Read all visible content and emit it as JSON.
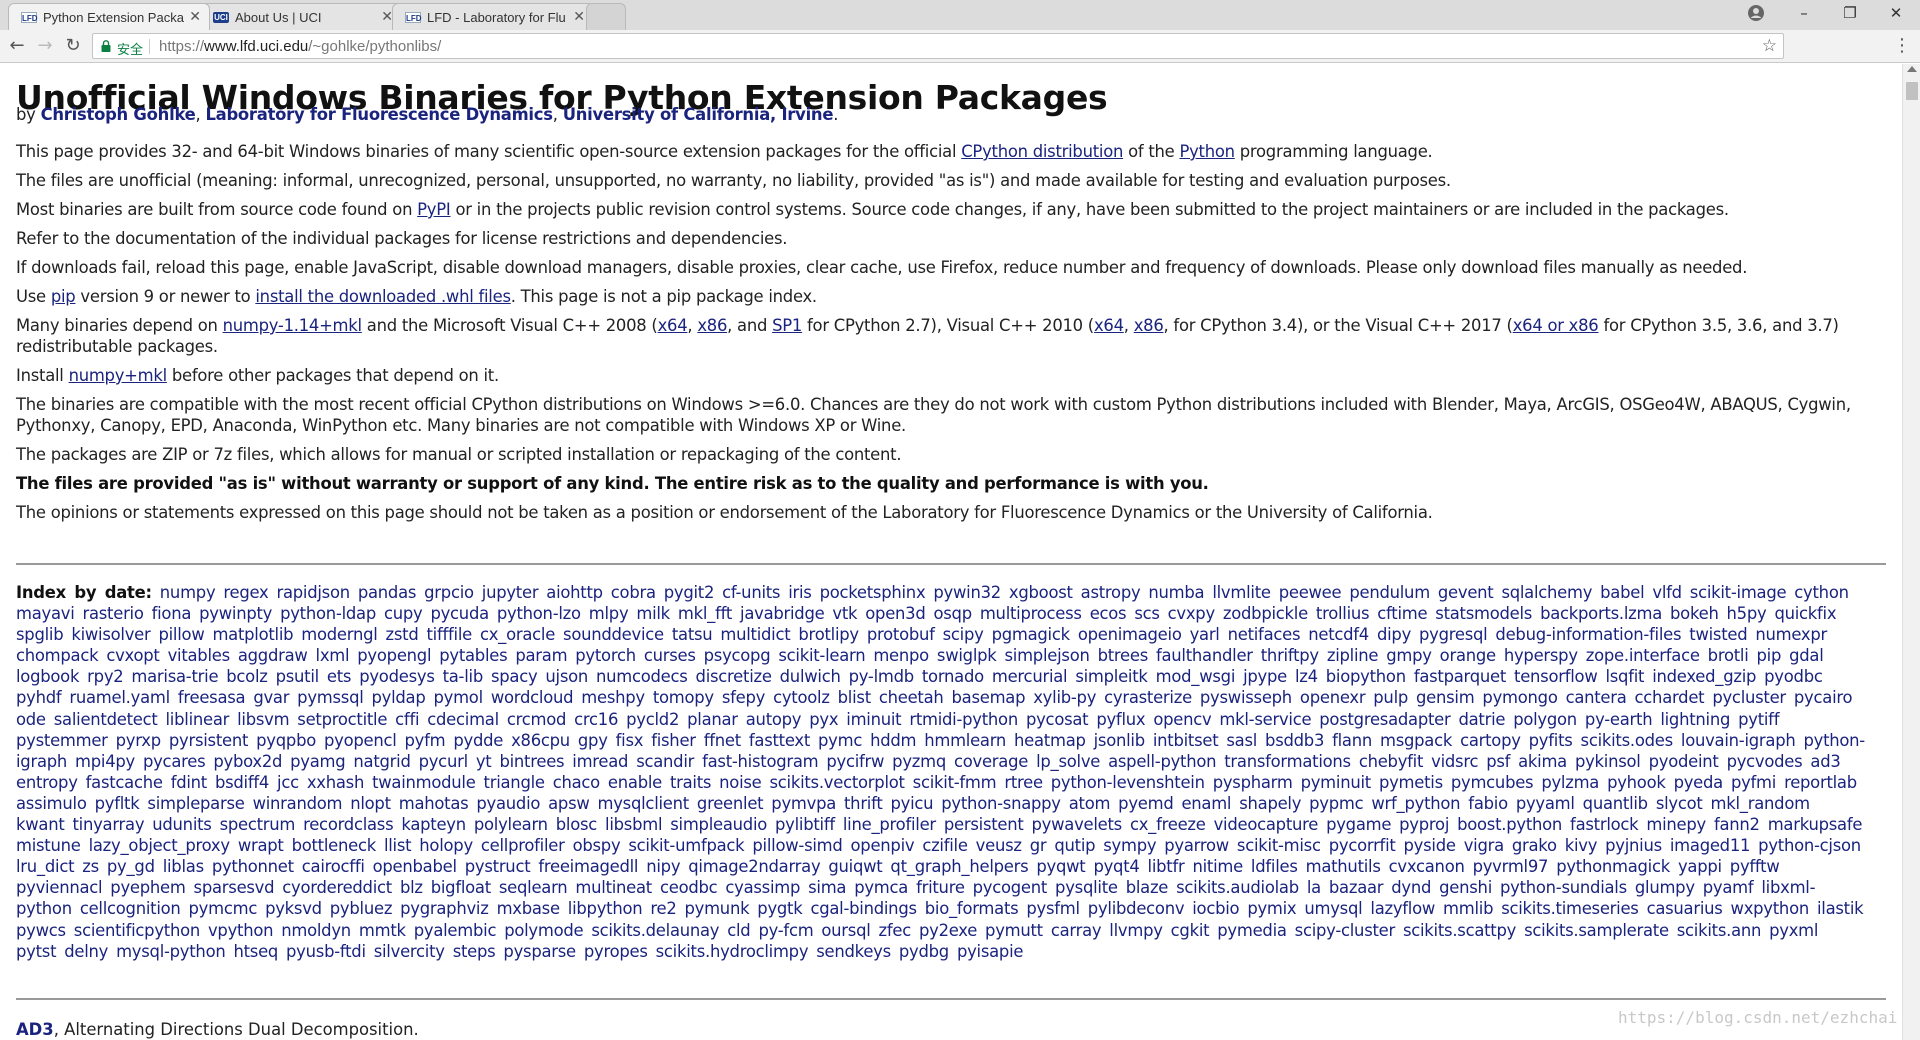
{
  "tabs": [
    {
      "icon": "LFD",
      "title": "Python Extension Packa",
      "active": true
    },
    {
      "icon": "UCI",
      "title": "About Us | UCI",
      "active": false
    },
    {
      "icon": "LFD",
      "title": "LFD - Laboratory for Flu",
      "active": false
    }
  ],
  "window_controls": {
    "minimize": "–",
    "restore": "❐",
    "close": "✕"
  },
  "address_bar": {
    "secure_label": "安全",
    "url_scheme": "https://",
    "url_host": "www.lfd.uci.edu",
    "url_path": "/~gohlke/pythonlibs/"
  },
  "page": {
    "title": "Unofficial Windows Binaries for Python Extension Packages",
    "byline": {
      "by": "by ",
      "author": "Christoph Gohlke",
      "sep1": ", ",
      "lab": "Laboratory for Fluorescence Dynamics",
      "sep2": ", ",
      "uni": "University of California, Irvine",
      "end": "."
    },
    "p1": {
      "a": "This page provides 32- and 64-bit Windows binaries of many scientific open-source extension packages for the official ",
      "link1": "CPython distribution",
      "b": " of the ",
      "link2": "Python",
      "c": " programming language."
    },
    "p2": "The files are unofficial (meaning: informal, unrecognized, personal, unsupported, no warranty, no liability, provided \"as is\") and made available for testing and evaluation purposes.",
    "p3": {
      "a": "Most binaries are built from source code found on ",
      "link": "PyPI",
      "b": " or in the projects public revision control systems. Source code changes, if any, have been submitted to the project maintainers or are included in the packages."
    },
    "p4": "Refer to the documentation of the individual packages for license restrictions and dependencies.",
    "p5": "If downloads fail, reload this page, enable JavaScript, disable download managers, disable proxies, clear cache, use Firefox, reduce number and frequency of downloads. Please only download files manually as needed.",
    "p6": {
      "a": "Use ",
      "link1": "pip",
      "b": " version 9 or newer to ",
      "link2": "install the downloaded .whl files",
      "c": ". This page is not a pip package index."
    },
    "p7": {
      "a": "Many binaries depend on ",
      "l1": "numpy-1.14+mkl",
      "b": " and the Microsoft Visual C++ 2008 (",
      "l2": "x64",
      "c": ", ",
      "l3": "x86",
      "d": ", and ",
      "l4": "SP1",
      "e": " for CPython 2.7), Visual C++ 2010 (",
      "l5": "x64",
      "f": ", ",
      "l6": "x86",
      "g": ", for CPython 3.4), or the Visual C++ 2017 (",
      "l7": "x64 or x86",
      "h": " for CPython 3.5, 3.6, and 3.7) redistributable packages."
    },
    "p8": {
      "a": "Install ",
      "link": "numpy+mkl",
      "b": " before other packages that depend on it."
    },
    "p9": "The binaries are compatible with the most recent official CPython distributions on Windows >=6.0. Chances are they do not work with custom Python distributions included with Blender, Maya, ArcGIS, OSGeo4W, ABAQUS, Cygwin, Pythonxy, Canopy, EPD, Anaconda, WinPython etc. Many binaries are not compatible with Windows XP or Wine.",
    "p10": "The packages are ZIP or 7z files, which allows for manual or scripted installation or repackaging of the content.",
    "p11": "The files are provided \"as is\" without warranty or support of any kind. The entire risk as to the quality and performance is with you.",
    "p12": "The opinions or statements expressed on this page should not be taken as a position or endorsement of the Laboratory for Fluorescence Dynamics or the University of California.",
    "index_label": "Index by date:",
    "index": [
      "numpy",
      "regex",
      "rapidjson",
      "pandas",
      "grpcio",
      "jupyter",
      "aiohttp",
      "cobra",
      "pygit2",
      "cf-units",
      "iris",
      "pocketsphinx",
      "pywin32",
      "xgboost",
      "astropy",
      "numba",
      "llvmlite",
      "peewee",
      "pendulum",
      "gevent",
      "sqlalchemy",
      "babel",
      "vlfd",
      "scikit-image",
      "cython",
      "mayavi",
      "rasterio",
      "fiona",
      "pywinpty",
      "python-ldap",
      "cupy",
      "pycuda",
      "python-lzo",
      "mlpy",
      "milk",
      "mkl_fft",
      "javabridge",
      "vtk",
      "open3d",
      "osqp",
      "multiprocess",
      "ecos",
      "scs",
      "cvxpy",
      "zodbpickle",
      "trollius",
      "cftime",
      "statsmodels",
      "backports.lzma",
      "bokeh",
      "h5py",
      "quickfix",
      "spglib",
      "kiwisolver",
      "pillow",
      "matplotlib",
      "moderngl",
      "zstd",
      "tifffile",
      "cx_oracle",
      "sounddevice",
      "tatsu",
      "multidict",
      "brotlipy",
      "protobuf",
      "scipy",
      "pgmagick",
      "openimageio",
      "yarl",
      "netifaces",
      "netcdf4",
      "dipy",
      "pygresql",
      "debug-information-files",
      "twisted",
      "numexpr",
      "chompack",
      "cvxopt",
      "vitables",
      "aggdraw",
      "lxml",
      "pyopengl",
      "pytables",
      "param",
      "pytorch",
      "curses",
      "psycopg",
      "scikit-learn",
      "menpo",
      "swiglpk",
      "simplejson",
      "btrees",
      "faulthandler",
      "thriftpy",
      "zipline",
      "gmpy",
      "orange",
      "hyperspy",
      "zope.interface",
      "brotli",
      "pip",
      "gdal",
      "logbook",
      "rpy2",
      "marisa-trie",
      "bcolz",
      "psutil",
      "ets",
      "pyodesys",
      "ta-lib",
      "spacy",
      "ujson",
      "numcodecs",
      "discretize",
      "dulwich",
      "py-lmdb",
      "tornado",
      "mercurial",
      "simpleitk",
      "mod_wsgi",
      "jpype",
      "lz4",
      "biopython",
      "fastparquet",
      "tensorflow",
      "lsqfit",
      "indexed_gzip",
      "pyodbc",
      "pyhdf",
      "ruamel.yaml",
      "freesasa",
      "gvar",
      "pymssql",
      "pyldap",
      "pymol",
      "wordcloud",
      "meshpy",
      "tomopy",
      "sfepy",
      "cytoolz",
      "blist",
      "cheetah",
      "basemap",
      "xylib-py",
      "cyrasterize",
      "pyswisseph",
      "openexr",
      "pulp",
      "gensim",
      "pymongo",
      "cantera",
      "cchardet",
      "pycluster",
      "pycairo",
      "ode",
      "salientdetect",
      "liblinear",
      "libsvm",
      "setproctitle",
      "cffi",
      "cdecimal",
      "crcmod",
      "crc16",
      "pycld2",
      "planar",
      "autopy",
      "pyx",
      "iminuit",
      "rtmidi-python",
      "pycosat",
      "pyflux",
      "opencv",
      "mkl-service",
      "postgresadapter",
      "datrie",
      "polygon",
      "py-earth",
      "lightning",
      "pytiff",
      "pystemmer",
      "pyrxp",
      "pyrsistent",
      "pyqpbo",
      "pyopencl",
      "pyfm",
      "pydde",
      "x86cpu",
      "gpy",
      "fisx",
      "fisher",
      "ffnet",
      "fasttext",
      "pymc",
      "hddm",
      "hmmlearn",
      "heatmap",
      "jsonlib",
      "intbitset",
      "sasl",
      "bsddb3",
      "flann",
      "msgpack",
      "cartopy",
      "pyfits",
      "scikits.odes",
      "louvain-igraph",
      "python-igraph",
      "mpi4py",
      "pycares",
      "pybox2d",
      "pyamg",
      "natgrid",
      "pycurl",
      "yt",
      "bintrees",
      "imread",
      "scandir",
      "fast-histogram",
      "pycifrw",
      "pyzmq",
      "coverage",
      "lp_solve",
      "aspell-python",
      "transformations",
      "chebyfit",
      "vidsrc",
      "psf",
      "akima",
      "pykinsol",
      "pyodeint",
      "pycvodes",
      "ad3",
      "entropy",
      "fastcache",
      "fdint",
      "bsdiff4",
      "jcc",
      "xxhash",
      "twainmodule",
      "triangle",
      "chaco",
      "enable",
      "traits",
      "noise",
      "scikits.vectorplot",
      "scikit-fmm",
      "rtree",
      "python-levenshtein",
      "pyspharm",
      "pyminuit",
      "pymetis",
      "pymcubes",
      "pylzma",
      "pyhook",
      "pyeda",
      "pyfmi",
      "reportlab",
      "assimulo",
      "pyfltk",
      "simpleparse",
      "winrandom",
      "nlopt",
      "mahotas",
      "pyaudio",
      "apsw",
      "mysqlclient",
      "greenlet",
      "pymvpa",
      "thrift",
      "pyicu",
      "python-snappy",
      "atom",
      "pyemd",
      "enaml",
      "shapely",
      "pypmc",
      "wrf_python",
      "fabio",
      "pyyaml",
      "quantlib",
      "slycot",
      "mkl_random",
      "kwant",
      "tinyarray",
      "udunits",
      "spectrum",
      "recordclass",
      "kapteyn",
      "polylearn",
      "blosc",
      "libsbml",
      "simpleaudio",
      "pylibtiff",
      "line_profiler",
      "persistent",
      "pywavelets",
      "cx_freeze",
      "videocapture",
      "pygame",
      "pyproj",
      "boost.python",
      "fastrlock",
      "minepy",
      "fann2",
      "markupsafe",
      "mistune",
      "lazy_object_proxy",
      "wrapt",
      "bottleneck",
      "llist",
      "holopy",
      "cellprofiler",
      "obspy",
      "scikit-umfpack",
      "pillow-simd",
      "openpiv",
      "czifile",
      "veusz",
      "gr",
      "qutip",
      "sympy",
      "pyarrow",
      "scikit-misc",
      "pycorrfit",
      "pyside",
      "vigra",
      "grako",
      "kivy",
      "pyjnius",
      "imaged11",
      "python-cjson",
      "lru_dict",
      "zs",
      "py_gd",
      "liblas",
      "pythonnet",
      "cairocffi",
      "openbabel",
      "pystruct",
      "freeimagedll",
      "nipy",
      "qimage2ndarray",
      "guiqwt",
      "qt_graph_helpers",
      "pyqwt",
      "pyqt4",
      "libtfr",
      "nitime",
      "ldfiles",
      "mathutils",
      "cvxcanon",
      "pyvrml97",
      "pythonmagick",
      "yappi",
      "pyfftw",
      "pyviennacl",
      "pyephem",
      "sparsesvd",
      "cyordereddict",
      "blz",
      "bigfloat",
      "seqlearn",
      "multineat",
      "ceodbc",
      "cyassimp",
      "sima",
      "pymca",
      "friture",
      "pycogent",
      "pysqlite",
      "blaze",
      "scikits.audiolab",
      "la",
      "bazaar",
      "dynd",
      "genshi",
      "python-sundials",
      "glumpy",
      "pyamf",
      "libxml-python",
      "cellcognition",
      "pymcmc",
      "pyksvd",
      "pybluez",
      "pygraphviz",
      "mxbase",
      "libpython",
      "re2",
      "pymunk",
      "pygtk",
      "cgal-bindings",
      "bio_formats",
      "pysfml",
      "pylibdeconv",
      "iocbio",
      "pymix",
      "umysql",
      "lazyflow",
      "mmlib",
      "scikits.timeseries",
      "casuarius",
      "wxpython",
      "ilastik",
      "pywcs",
      "scientificpython",
      "vpython",
      "nmoldyn",
      "mmtk",
      "pyalembic",
      "polymode",
      "scikits.delaunay",
      "cld",
      "py-fcm",
      "oursql",
      "zfec",
      "py2exe",
      "pymutt",
      "carray",
      "llvmpy",
      "cgkit",
      "pymedia",
      "scipy-cluster",
      "scikits.scattpy",
      "scikits.samplerate",
      "scikits.ann",
      "pyxml",
      "pytst",
      "delny",
      "mysql-python",
      "htseq",
      "pyusb-ftdi",
      "silvercity",
      "steps",
      "pysparse",
      "pyropes",
      "scikits.hydroclimpy",
      "sendkeys",
      "pydbg",
      "pyisapie"
    ],
    "ad3": {
      "name": "AD3",
      "desc": ", Alternating Directions Dual Decomposition."
    }
  },
  "watermark": "https://blog.csdn.net/ezhchai",
  "colors": {
    "link": "#1a237e",
    "secure": "#0b8043",
    "chrome_bg": "#f2f2f2"
  }
}
